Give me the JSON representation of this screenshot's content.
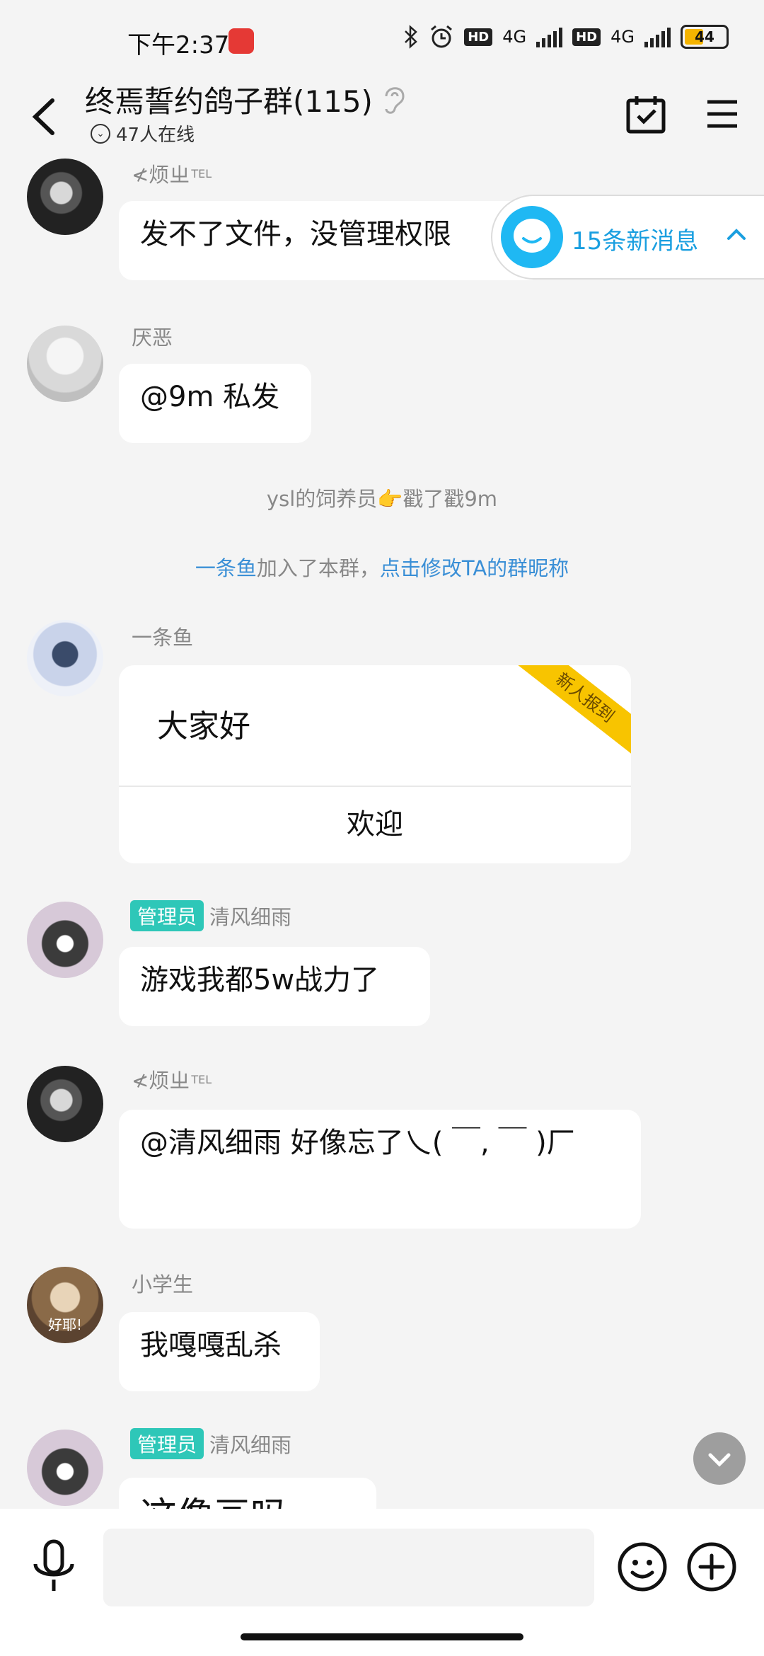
{
  "status_bar": {
    "time": "下午2:37",
    "network_1": "4G",
    "network_2": "4G",
    "hd_label": "HD",
    "battery": "44"
  },
  "header": {
    "title": "终焉誓约鸽子群(115)",
    "online": "47人在线"
  },
  "new_messages_pill": {
    "label": "15条新消息"
  },
  "messages": [
    {
      "nick": "≮烦ㄓ",
      "nick_sup": "TEL",
      "text": "发不了文件，没管理权限"
    },
    {
      "nick": "厌恶",
      "text": "@9m 私发"
    }
  ],
  "system": {
    "poke_text": "ysl的饲养员👉戳了戳9m",
    "join_name": "一条鱼",
    "join_mid": "加入了本群，",
    "join_link": "点击修改TA的群昵称"
  },
  "new_member_card": {
    "nick": "一条鱼",
    "greeting": "大家好",
    "ribbon": "新人报到",
    "welcome_button": "欢迎"
  },
  "messages_2": [
    {
      "badge": "管理员",
      "nick": "清风细雨",
      "text": "游戏我都5w战力了"
    },
    {
      "nick": "≮烦ㄓ",
      "nick_sup": "TEL",
      "text": "@清风细雨 好像忘了乀( ￣, ￣ )厂"
    },
    {
      "nick": "小学生",
      "avatar_text": "好耶!",
      "text": "我嘎嘎乱杀"
    },
    {
      "badge": "管理员",
      "nick": "清风细雨",
      "text": "这像画吗"
    }
  ],
  "colors": {
    "background": "#f4f4f4",
    "admin_badge": "#2ec7b8",
    "link": "#3a8fd6",
    "pill_text": "#1a9fe0",
    "ribbon": "#f8c400"
  }
}
